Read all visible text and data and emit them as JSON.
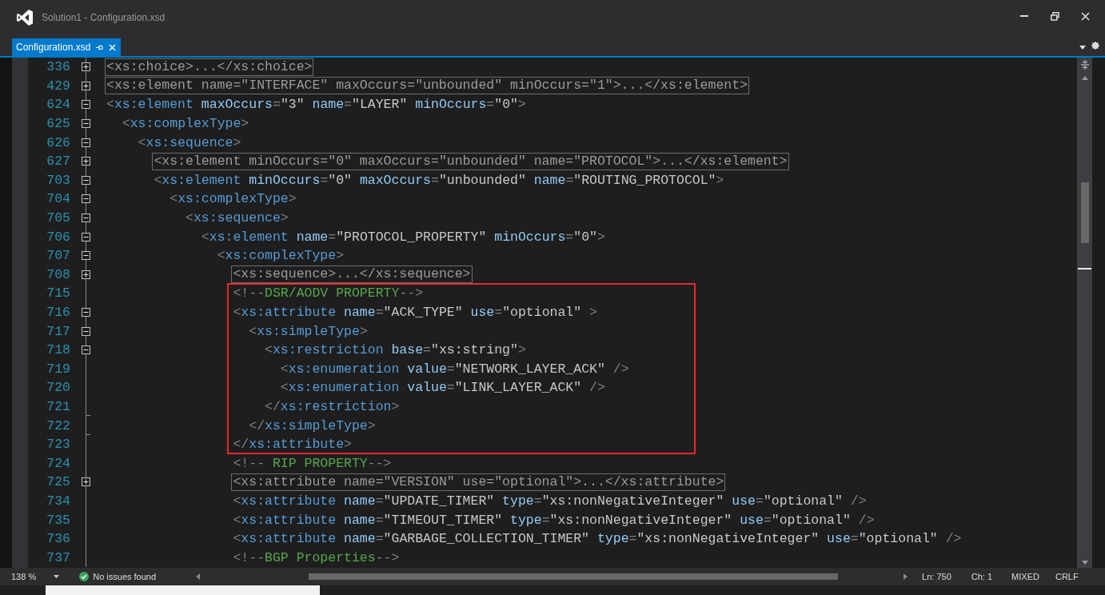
{
  "window": {
    "title": "Solution1 - Configuration.xsd"
  },
  "tabs": [
    {
      "label": "Configuration.xsd",
      "selected": true
    }
  ],
  "blocks": [
    {
      "highlighted": false,
      "lines": [
        {
          "number": "336",
          "kind": "collapsed",
          "tokens": [
            {
              "kind": "collapsed",
              "text": "<xs:choice>...</xs:choice>"
            }
          ]
        },
        {
          "number": "429",
          "kind": "collapsed",
          "tokens": [
            {
              "kind": "collapsed",
              "text": "<xs:element name=\"INTERFACE\" maxOccurs=\"unbounded\" minOccurs=\"1\">...</xs:element>"
            }
          ]
        },
        {
          "number": "624",
          "kind": "expanded",
          "tokens": [
            {
              "kind": "punct",
              "text": "<"
            },
            {
              "kind": "tag",
              "text": "xs:element"
            },
            {
              "kind": "attr",
              "text": " maxOccurs"
            },
            {
              "kind": "punct",
              "text": "="
            },
            {
              "kind": "value",
              "text": "\"3\""
            },
            {
              "kind": "attr",
              "text": " name"
            },
            {
              "kind": "punct",
              "text": "="
            },
            {
              "kind": "value",
              "text": "\"LAYER\""
            },
            {
              "kind": "attr",
              "text": " minOccurs"
            },
            {
              "kind": "punct",
              "text": "="
            },
            {
              "kind": "value",
              "text": "\"0\""
            },
            {
              "kind": "punct",
              "text": ">"
            }
          ]
        },
        {
          "number": "625",
          "kind": "expanded",
          "tokens": [
            {
              "kind": "punct",
              "text": "  <"
            },
            {
              "kind": "tag",
              "text": "xs:complexType"
            },
            {
              "kind": "punct",
              "text": ">"
            }
          ]
        },
        {
          "number": "626",
          "kind": "expanded",
          "tokens": [
            {
              "kind": "punct",
              "text": "    <"
            },
            {
              "kind": "tag",
              "text": "xs:sequence"
            },
            {
              "kind": "punct",
              "text": ">"
            }
          ]
        },
        {
          "number": "627",
          "kind": "collapsed",
          "tokens": [
            {
              "kind": "collapsed",
              "text": "      <xs:element minOccurs=\"0\" maxOccurs=\"unbounded\" name=\"PROTOCOL\">...</xs:element>"
            }
          ]
        },
        {
          "number": "703",
          "kind": "expanded",
          "tokens": [
            {
              "kind": "punct",
              "text": "      <"
            },
            {
              "kind": "tag",
              "text": "xs:element"
            },
            {
              "kind": "attr",
              "text": " minOccurs"
            },
            {
              "kind": "punct",
              "text": "="
            },
            {
              "kind": "value",
              "text": "\"0\""
            },
            {
              "kind": "attr",
              "text": " maxOccurs"
            },
            {
              "kind": "punct",
              "text": "="
            },
            {
              "kind": "value",
              "text": "\"unbounded\""
            },
            {
              "kind": "attr",
              "text": " name"
            },
            {
              "kind": "punct",
              "text": "="
            },
            {
              "kind": "value",
              "text": "\"ROUTING_PROTOCOL\""
            },
            {
              "kind": "punct",
              "text": ">"
            }
          ]
        },
        {
          "number": "704",
          "kind": "expanded",
          "tokens": [
            {
              "kind": "punct",
              "text": "        <"
            },
            {
              "kind": "tag",
              "text": "xs:complexType"
            },
            {
              "kind": "punct",
              "text": ">"
            }
          ]
        },
        {
          "number": "705",
          "kind": "expanded",
          "tokens": [
            {
              "kind": "punct",
              "text": "          <"
            },
            {
              "kind": "tag",
              "text": "xs:sequence"
            },
            {
              "kind": "punct",
              "text": ">"
            }
          ]
        },
        {
          "number": "706",
          "kind": "expanded",
          "tokens": [
            {
              "kind": "punct",
              "text": "            <"
            },
            {
              "kind": "tag",
              "text": "xs:element"
            },
            {
              "kind": "attr",
              "text": " name"
            },
            {
              "kind": "punct",
              "text": "="
            },
            {
              "kind": "value",
              "text": "\"PROTOCOL_PROPERTY\""
            },
            {
              "kind": "attr",
              "text": " minOccurs"
            },
            {
              "kind": "punct",
              "text": "="
            },
            {
              "kind": "value",
              "text": "\"0\""
            },
            {
              "kind": "punct",
              "text": ">"
            }
          ]
        },
        {
          "number": "707",
          "kind": "expanded",
          "tokens": [
            {
              "kind": "punct",
              "text": "              <"
            },
            {
              "kind": "tag",
              "text": "xs:complexType"
            },
            {
              "kind": "punct",
              "text": ">"
            }
          ]
        },
        {
          "number": "708",
          "kind": "collapsed",
          "tokens": [
            {
              "kind": "collapsed",
              "text": "                <xs:sequence>...</xs:sequence>"
            }
          ]
        }
      ]
    },
    {
      "highlighted": true,
      "lines": [
        {
          "number": "715",
          "kind": "plain",
          "tokens": [
            {
              "kind": "punct",
              "text": "                <!--"
            },
            {
              "kind": "comment",
              "text": "DSR/AODV PROPERTY"
            },
            {
              "kind": "punct",
              "text": "-->"
            }
          ]
        },
        {
          "number": "716",
          "kind": "expanded",
          "tokens": [
            {
              "kind": "punct",
              "text": "                <"
            },
            {
              "kind": "tag",
              "text": "xs:attribute"
            },
            {
              "kind": "attr",
              "text": " name"
            },
            {
              "kind": "punct",
              "text": "="
            },
            {
              "kind": "value",
              "text": "\"ACK_TYPE\""
            },
            {
              "kind": "attr",
              "text": " use"
            },
            {
              "kind": "punct",
              "text": "="
            },
            {
              "kind": "value",
              "text": "\"optional\""
            },
            {
              "kind": "punct",
              "text": " >"
            }
          ]
        },
        {
          "number": "717",
          "kind": "expanded",
          "tokens": [
            {
              "kind": "punct",
              "text": "                  <"
            },
            {
              "kind": "tag",
              "text": "xs:simpleType"
            },
            {
              "kind": "punct",
              "text": ">"
            }
          ]
        },
        {
          "number": "718",
          "kind": "expanded",
          "tokens": [
            {
              "kind": "punct",
              "text": "                    <"
            },
            {
              "kind": "tag",
              "text": "xs:restriction"
            },
            {
              "kind": "attr",
              "text": " base"
            },
            {
              "kind": "punct",
              "text": "="
            },
            {
              "kind": "value",
              "text": "\"xs:string\""
            },
            {
              "kind": "punct",
              "text": ">"
            }
          ]
        },
        {
          "number": "719",
          "kind": "plain",
          "tokens": [
            {
              "kind": "punct",
              "text": "                      <"
            },
            {
              "kind": "tag",
              "text": "xs:enumeration"
            },
            {
              "kind": "attr",
              "text": " value"
            },
            {
              "kind": "punct",
              "text": "="
            },
            {
              "kind": "value",
              "text": "\"NETWORK_LAYER_ACK\""
            },
            {
              "kind": "punct",
              "text": " />"
            }
          ]
        },
        {
          "number": "720",
          "kind": "plain",
          "tokens": [
            {
              "kind": "punct",
              "text": "                      <"
            },
            {
              "kind": "tag",
              "text": "xs:enumeration"
            },
            {
              "kind": "attr",
              "text": " value"
            },
            {
              "kind": "punct",
              "text": "="
            },
            {
              "kind": "value",
              "text": "\"LINK_LAYER_ACK\""
            },
            {
              "kind": "punct",
              "text": " />"
            }
          ]
        },
        {
          "number": "721",
          "kind": "end",
          "tokens": [
            {
              "kind": "punct",
              "text": "                    </"
            },
            {
              "kind": "tag",
              "text": "xs:restriction"
            },
            {
              "kind": "punct",
              "text": ">"
            }
          ]
        },
        {
          "number": "722",
          "kind": "end",
          "tokens": [
            {
              "kind": "punct",
              "text": "                  </"
            },
            {
              "kind": "tag",
              "text": "xs:simpleType"
            },
            {
              "kind": "punct",
              "text": ">"
            }
          ]
        },
        {
          "number": "723",
          "kind": "plain",
          "tokens": [
            {
              "kind": "punct",
              "text": "                </"
            },
            {
              "kind": "tag",
              "text": "xs:attribute"
            },
            {
              "kind": "punct",
              "text": ">"
            }
          ]
        }
      ]
    },
    {
      "highlighted": false,
      "lines": [
        {
          "number": "724",
          "kind": "plain",
          "tokens": [
            {
              "kind": "punct",
              "text": "                <!--"
            },
            {
              "kind": "comment",
              "text": " RIP PROPERTY"
            },
            {
              "kind": "punct",
              "text": "-->"
            }
          ]
        },
        {
          "number": "725",
          "kind": "collapsed",
          "tokens": [
            {
              "kind": "collapsed",
              "text": "                <xs:attribute name=\"VERSION\" use=\"optional\">...</xs:attribute>"
            }
          ]
        },
        {
          "number": "734",
          "kind": "plain",
          "tokens": [
            {
              "kind": "punct",
              "text": "                <"
            },
            {
              "kind": "tag",
              "text": "xs:attribute"
            },
            {
              "kind": "attr",
              "text": " name"
            },
            {
              "kind": "punct",
              "text": "="
            },
            {
              "kind": "value",
              "text": "\"UPDATE_TIMER\""
            },
            {
              "kind": "attr",
              "text": " type"
            },
            {
              "kind": "punct",
              "text": "="
            },
            {
              "kind": "value",
              "text": "\"xs:nonNegativeInteger\""
            },
            {
              "kind": "attr",
              "text": " use"
            },
            {
              "kind": "punct",
              "text": "="
            },
            {
              "kind": "value",
              "text": "\"optional\""
            },
            {
              "kind": "punct",
              "text": " />"
            }
          ]
        },
        {
          "number": "735",
          "kind": "plain",
          "tokens": [
            {
              "kind": "punct",
              "text": "                <"
            },
            {
              "kind": "tag",
              "text": "xs:attribute"
            },
            {
              "kind": "attr",
              "text": " name"
            },
            {
              "kind": "punct",
              "text": "="
            },
            {
              "kind": "value",
              "text": "\"TIMEOUT_TIMER\""
            },
            {
              "kind": "attr",
              "text": " type"
            },
            {
              "kind": "punct",
              "text": "="
            },
            {
              "kind": "value",
              "text": "\"xs:nonNegativeInteger\""
            },
            {
              "kind": "attr",
              "text": " use"
            },
            {
              "kind": "punct",
              "text": "="
            },
            {
              "kind": "value",
              "text": "\"optional\""
            },
            {
              "kind": "punct",
              "text": " />"
            }
          ]
        },
        {
          "number": "736",
          "kind": "plain",
          "tokens": [
            {
              "kind": "punct",
              "text": "                <"
            },
            {
              "kind": "tag",
              "text": "xs:attribute"
            },
            {
              "kind": "attr",
              "text": " name"
            },
            {
              "kind": "punct",
              "text": "="
            },
            {
              "kind": "value",
              "text": "\"GARBAGE_COLLECTION_TIMER\""
            },
            {
              "kind": "attr",
              "text": " type"
            },
            {
              "kind": "punct",
              "text": "="
            },
            {
              "kind": "value",
              "text": "\"xs:nonNegativeInteger\""
            },
            {
              "kind": "attr",
              "text": " use"
            },
            {
              "kind": "punct",
              "text": "="
            },
            {
              "kind": "value",
              "text": "\"optional\""
            },
            {
              "kind": "punct",
              "text": " />"
            }
          ]
        },
        {
          "number": "737",
          "kind": "plain",
          "tokens": [
            {
              "kind": "punct",
              "text": "                <!--"
            },
            {
              "kind": "comment",
              "text": "BGP Properties"
            },
            {
              "kind": "punct",
              "text": "-->"
            }
          ]
        }
      ]
    }
  ],
  "status_bar": {
    "zoom": "138 %",
    "issues": "No issues found",
    "line": "Ln: 750",
    "column": "Ch: 1",
    "encoding": "MIXED",
    "line_endings": "CRLF"
  }
}
